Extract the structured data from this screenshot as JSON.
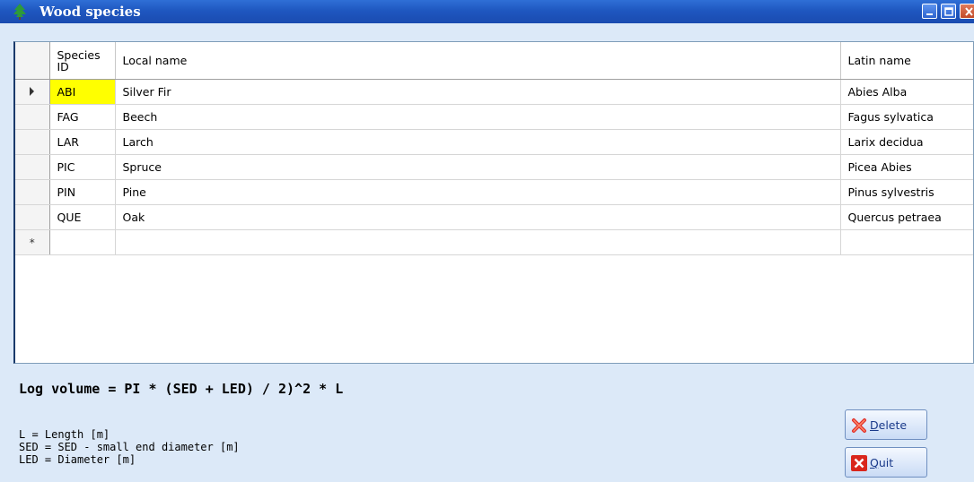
{
  "window": {
    "title": "Wood species"
  },
  "grid": {
    "columns": [
      "Species ID",
      "Local name",
      "Latin name"
    ],
    "current_row": 0,
    "rows": [
      {
        "id": "ABI",
        "local": "Silver Fir",
        "latin": "Abies Alba"
      },
      {
        "id": "FAG",
        "local": "Beech",
        "latin": "Fagus sylvatica"
      },
      {
        "id": "LAR",
        "local": "Larch",
        "latin": "Larix decidua"
      },
      {
        "id": "PIC",
        "local": "Spruce",
        "latin": "Picea Abies"
      },
      {
        "id": "PIN",
        "local": "Pine",
        "latin": "Pinus sylvestris"
      },
      {
        "id": "QUE",
        "local": "Oak",
        "latin": "Quercus petraea"
      }
    ],
    "new_row_marker": "*"
  },
  "formula": "Log volume = PI * (SED + LED) / 2)^2 * L",
  "legend": [
    "L = Length [m]",
    "SED = SED - small end diameter [m]",
    "LED = Diameter [m]"
  ],
  "buttons": {
    "delete": {
      "accel": "D",
      "rest": "elete"
    },
    "quit": {
      "accel": "Q",
      "rest": "uit"
    }
  },
  "colors": {
    "selected_cell": "#ffff00",
    "titlebar": "#1f57c0"
  }
}
